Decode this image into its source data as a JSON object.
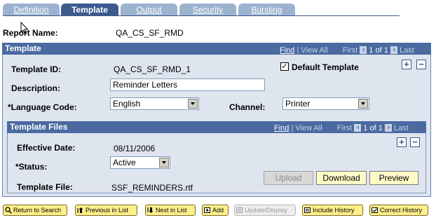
{
  "tabs": [
    {
      "label": "Definition"
    },
    {
      "label": "Template"
    },
    {
      "label": "Output"
    },
    {
      "label": "Security"
    },
    {
      "label": "Bursting"
    }
  ],
  "report_name": {
    "label": "Report Name:",
    "value": "QA_CS_SF_RMD"
  },
  "template_panel": {
    "title": "Template",
    "nav": {
      "find": "Find",
      "view_all": "View All",
      "first": "First",
      "counter": "1 of 1",
      "last": "Last"
    },
    "template_id_label": "Template ID:",
    "template_id_value": "QA_CS_SF_RMD_1",
    "default_template_label": "Default Template",
    "default_template_checked": true,
    "description_label": "Description:",
    "description_value": "Reminder Letters",
    "language_label": "*Language Code:",
    "language_value": "English",
    "channel_label": "Channel:",
    "channel_value": "Printer",
    "add_symbol": "+",
    "remove_symbol": "−"
  },
  "template_files_panel": {
    "title": "Template Files",
    "nav": {
      "find": "Find",
      "view_all": "View All",
      "first": "First",
      "counter": "1 of 1",
      "last": "Last"
    },
    "effective_date_label": "Effective Date:",
    "effective_date_value": "08/11/2006",
    "status_label": "*Status:",
    "status_value": "Active",
    "template_file_label": "Template File:",
    "template_file_value": "SSF_REMINDERS.rtf",
    "upload_label": "Upload",
    "download_label": "Download",
    "preview_label": "Preview",
    "add_symbol": "+",
    "remove_symbol": "−"
  },
  "toolbar": {
    "return_to_search": "Return to Search",
    "previous_in_list": "Previous in List",
    "next_in_list": "Next in List",
    "add": "Add",
    "update_display": "Update/Display",
    "include_history": "Include History",
    "correct_history": "Correct History"
  },
  "colors": {
    "panel_header": "#4a6aa1",
    "active_tab": "#3d5a8f",
    "inactive_tab": "#9cb2cf",
    "button_yellow": "#fffbc8",
    "toolbar_yellow": "#ffef8a"
  }
}
